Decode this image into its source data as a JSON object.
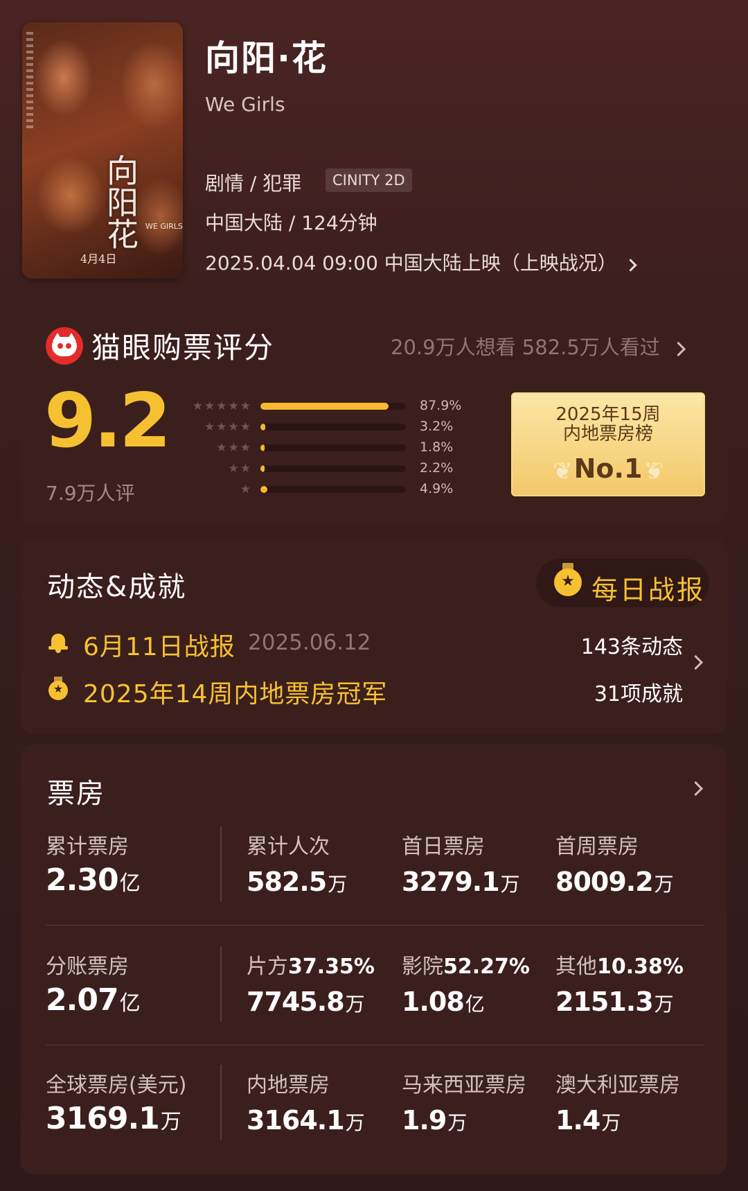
{
  "movie": {
    "title": "向阳·花",
    "english_title": "We Girls",
    "genre": "剧情 / 犯罪",
    "format_tag": "CINITY 2D",
    "region_duration": "中国大陆 / 124分钟",
    "release": "2025.04.04 09:00 中国大陆上映（上映战况）",
    "poster": {
      "title_text": "向阳花",
      "date_text": "4月4日",
      "english_text": "WE GIRLS"
    }
  },
  "rating": {
    "title": "猫眼购票评分",
    "meta": "20.9万人想看 582.5万人看过",
    "score": "9.2",
    "count": "7.9万人评",
    "distribution": [
      {
        "stars": 5,
        "percent": 87.9,
        "label": "87.9%"
      },
      {
        "stars": 4,
        "percent": 3.2,
        "label": "3.2%"
      },
      {
        "stars": 3,
        "percent": 1.8,
        "label": "1.8%"
      },
      {
        "stars": 2,
        "percent": 2.2,
        "label": "2.2%"
      },
      {
        "stars": 1,
        "percent": 4.9,
        "label": "4.9%"
      }
    ],
    "rank": {
      "line1": "2025年15周",
      "line2": "内地票房榜",
      "position": "No.1"
    }
  },
  "dynamics": {
    "title": "动态&成就",
    "daily_button": "每日战报",
    "report": {
      "title": "6月11日战报",
      "date": "2025.06.12",
      "count": "143条动态"
    },
    "achievement": {
      "title": "2025年14周内地票房冠军",
      "count": "31项成就"
    }
  },
  "box_office": {
    "title": "票房",
    "rows": [
      [
        {
          "label": "累计票房",
          "value": "2.30",
          "unit": "亿"
        },
        {
          "label": "累计人次",
          "value": "582.5",
          "unit": "万"
        },
        {
          "label": "首日票房",
          "value": "3279.1",
          "unit": "万"
        },
        {
          "label": "首周票房",
          "value": "8009.2",
          "unit": "万"
        }
      ],
      [
        {
          "label": "分账票房",
          "value": "2.07",
          "unit": "亿"
        },
        {
          "label": "片方",
          "label_value": "37.35%",
          "value": "7745.8",
          "unit": "万"
        },
        {
          "label": "影院",
          "label_value": "52.27%",
          "value": "1.08",
          "unit": "亿"
        },
        {
          "label": "其他",
          "label_value": "10.38%",
          "value": "2151.3",
          "unit": "万"
        }
      ],
      [
        {
          "label": "全球票房(美元)",
          "value": "3169.1",
          "unit": "万"
        },
        {
          "label": "内地票房",
          "value": "3164.1",
          "unit": "万"
        },
        {
          "label": "马来西亚票房",
          "value": "1.9",
          "unit": "万"
        },
        {
          "label": "澳大利亚票房",
          "value": "1.4",
          "unit": "万"
        }
      ]
    ]
  },
  "colors": {
    "accent": "#f6c131",
    "background": "#3a1e1d",
    "card": "#3b1f1d"
  }
}
